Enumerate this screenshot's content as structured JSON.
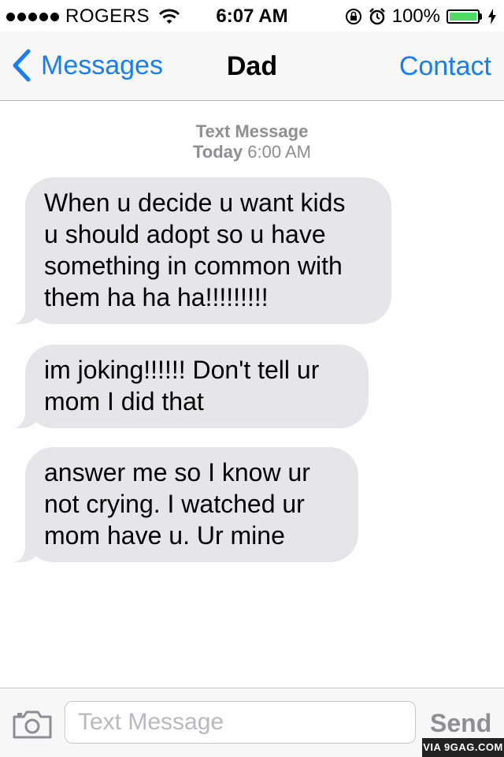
{
  "status_bar": {
    "carrier": "ROGERS",
    "time": "6:07 AM",
    "battery": "100%",
    "battery_level": 1.0,
    "battery_color": "#4cd964",
    "icons": [
      "signal-dots-icon",
      "wifi-icon",
      "rotation-lock-icon",
      "alarm-icon",
      "battery-icon",
      "charging-bolt-icon"
    ]
  },
  "nav": {
    "back_label": "Messages",
    "title": "Dad",
    "contact_label": "Contact",
    "accent": "#157efb"
  },
  "thread": {
    "header_type": "Text Message",
    "header_day": "Today",
    "header_time": "6:00 AM",
    "messages": [
      {
        "text": "When u decide u want kids\nu should adopt so u have\nsomething in common with\nthem ha ha ha!!!!!!!!!"
      },
      {
        "text": "im joking!!!!!! Don't tell ur\nmom I did that"
      },
      {
        "text": "answer me so I know ur\nnot crying. I watched ur\nmom have u. Ur mine"
      }
    ],
    "bubble_color": "#e5e5ea"
  },
  "input_bar": {
    "placeholder": "Text Message",
    "send_label": "Send",
    "camera_icon": "camera-icon"
  },
  "watermark": "VIA 9GAG.COM"
}
